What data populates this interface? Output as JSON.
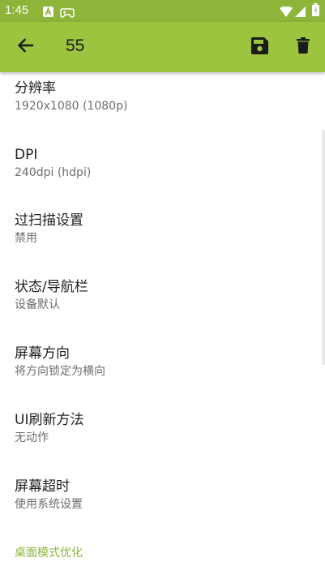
{
  "status": {
    "time": "1:45"
  },
  "appbar": {
    "title": "55",
    "back_icon": "arrow-left-icon",
    "save_icon": "save-icon",
    "delete_icon": "trash-icon"
  },
  "items": [
    {
      "title": "分辨率",
      "subtitle": "1920x1080 (1080p)"
    },
    {
      "title": "DPI",
      "subtitle": "240dpi (hdpi)"
    },
    {
      "title": "过扫描设置",
      "subtitle": "禁用"
    },
    {
      "title": "状态/导航栏",
      "subtitle": "设备默认"
    },
    {
      "title": "屏幕方向",
      "subtitle": "将方向锁定为横向"
    },
    {
      "title": "UI刷新方法",
      "subtitle": "无动作"
    },
    {
      "title": "屏幕超时",
      "subtitle": "使用系统设置"
    }
  ],
  "section": {
    "label": "桌面模式优化"
  },
  "colors": {
    "appbar": "#9cc43e",
    "statusbar": "#8fb43a",
    "accent": "#8cb43a"
  }
}
